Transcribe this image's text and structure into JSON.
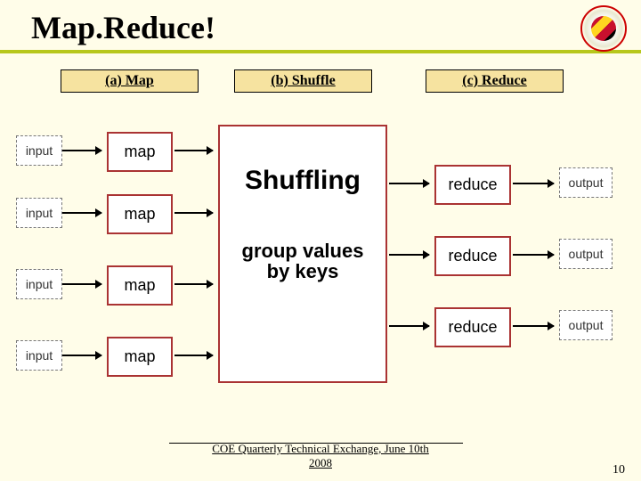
{
  "title": "Map.Reduce!",
  "phases": {
    "a": "(a) Map",
    "b": "(b) Shuffle",
    "c": "(c) Reduce"
  },
  "input_label": "input",
  "map_label": "map",
  "shuffle": {
    "title": "Shuffling",
    "sub1": "group values",
    "sub2": "by keys"
  },
  "reduce_label": "reduce",
  "output_label": "output",
  "footer": {
    "line1": "COE Quarterly Technical Exchange, June 10th",
    "line2": "2008"
  },
  "slide_number": "10"
}
